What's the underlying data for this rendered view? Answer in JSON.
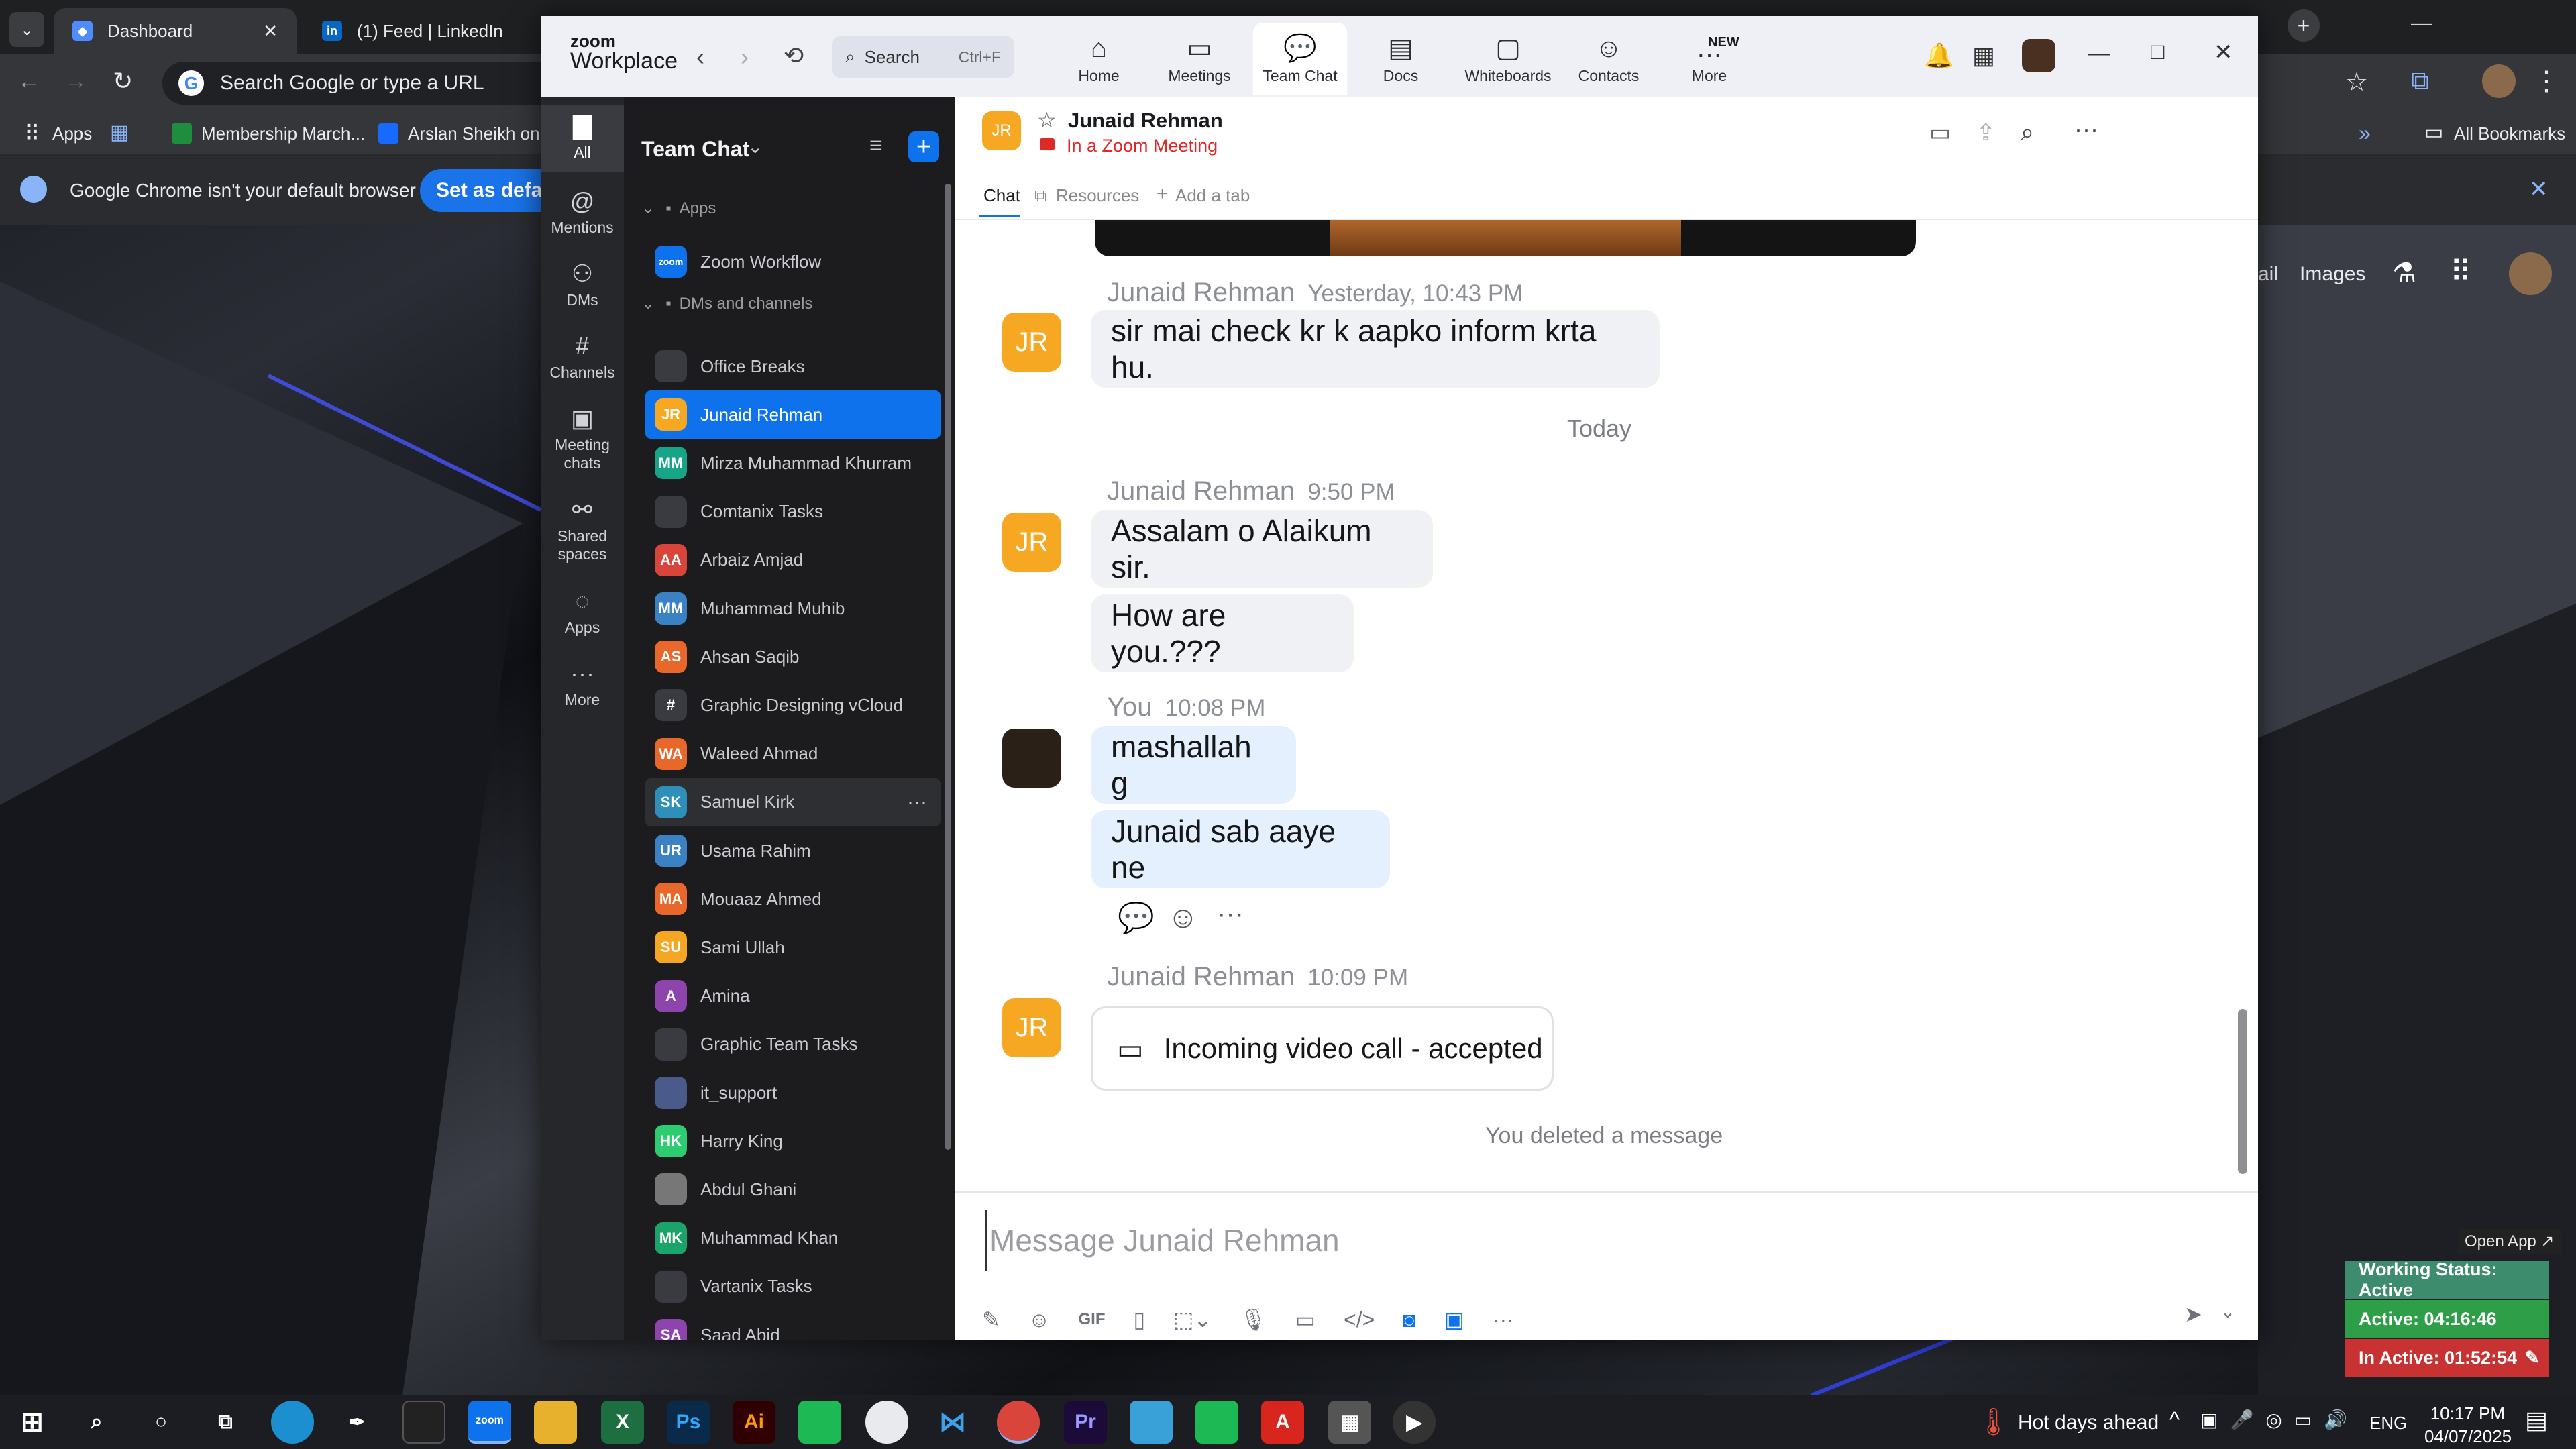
{
  "browser": {
    "tabs": [
      {
        "label": "Dashboard"
      },
      {
        "label": "(1) Feed | LinkedIn"
      }
    ],
    "address_placeholder": "Search Google or type a URL",
    "bookmarks": [
      "Apps",
      "Membership March...",
      "Arslan Sheikh on B"
    ],
    "all_bookmarks": "All Bookmarks",
    "info_text": "Google Chrome isn't your default browser",
    "info_button": "Set as default",
    "google_links": [
      "ail",
      "Images"
    ]
  },
  "zoom": {
    "brand_top": "zoom",
    "brand_bottom": "Workplace",
    "search_label": "Search",
    "search_shortcut": "Ctrl+F",
    "nav": [
      {
        "label": "Home",
        "icon": "home-icon"
      },
      {
        "label": "Meetings",
        "icon": "video-icon"
      },
      {
        "label": "Team Chat",
        "icon": "chat-icon"
      },
      {
        "label": "Docs",
        "icon": "doc-icon"
      },
      {
        "label": "Whiteboards",
        "icon": "whiteboard-icon"
      },
      {
        "label": "Contacts",
        "icon": "contacts-icon"
      },
      {
        "label": "More",
        "icon": "more-icon",
        "badge": "NEW"
      }
    ],
    "rail": [
      {
        "label": "All"
      },
      {
        "label": "Mentions"
      },
      {
        "label": "DMs"
      },
      {
        "label": "Channels"
      },
      {
        "label": "Meeting chats"
      },
      {
        "label": "Shared spaces"
      },
      {
        "label": "Apps"
      },
      {
        "label": "More"
      }
    ],
    "list_title": "Team Chat",
    "section_apps": "Apps",
    "app_item": "Zoom Workflow",
    "section_dms": "DMs and channels",
    "contacts": [
      {
        "name": "Office Breaks",
        "avatar": "",
        "color": "#3a3b40"
      },
      {
        "name": "Junaid Rehman",
        "avatar": "JR",
        "color": "#f7a823"
      },
      {
        "name": "Mirza Muhammad Khurram",
        "avatar": "MM",
        "color": "#17a589"
      },
      {
        "name": "Comtanix Tasks",
        "avatar": "",
        "color": "#3a3b40"
      },
      {
        "name": "Arbaiz Amjad",
        "avatar": "AA",
        "color": "#d9453b"
      },
      {
        "name": "Muhammad Muhib",
        "avatar": "MM",
        "color": "#3b82c4"
      },
      {
        "name": "Ahsan Saqib",
        "avatar": "AS",
        "color": "#e8672a"
      },
      {
        "name": "Graphic Designing vCloud",
        "avatar": "#",
        "color": "#3a3b40"
      },
      {
        "name": "Waleed Ahmad",
        "avatar": "WA",
        "color": "#e8672a"
      },
      {
        "name": "Samuel Kirk",
        "avatar": "SK",
        "color": "#2e8fb8"
      },
      {
        "name": "Usama Rahim",
        "avatar": "UR",
        "color": "#3b82c4"
      },
      {
        "name": "Mouaaz Ahmed",
        "avatar": "MA",
        "color": "#e8672a"
      },
      {
        "name": "Sami Ullah",
        "avatar": "SU",
        "color": "#f5a623"
      },
      {
        "name": "Amina",
        "avatar": "A",
        "color": "#8e44ad"
      },
      {
        "name": "Graphic Team Tasks",
        "avatar": "",
        "color": "#3a3b40"
      },
      {
        "name": "it_support",
        "avatar": "",
        "color": "#4a5a8a"
      },
      {
        "name": "Harry King",
        "avatar": "HK",
        "color": "#2ecc71"
      },
      {
        "name": "Abdul Ghani",
        "avatar": "",
        "color": "#777"
      },
      {
        "name": "Muhammad Khan",
        "avatar": "MK",
        "color": "#1aa36a"
      },
      {
        "name": "Vartanix Tasks",
        "avatar": "",
        "color": "#3a3b40"
      },
      {
        "name": "Saad Abid",
        "avatar": "SA",
        "color": "#8e44ad"
      }
    ],
    "chat": {
      "contact_name": "Junaid Rehman",
      "contact_status": "In a Zoom Meeting",
      "tabs": [
        "Chat",
        "Resources",
        "Add a tab"
      ],
      "m1_name": "Junaid Rehman",
      "m1_time": "Yesterday, 10:43 PM",
      "m1_text": "sir mai check kr k aapko inform krta hu.",
      "day_divider": "Today",
      "m2_name": "Junaid Rehman",
      "m2_time": "9:50 PM",
      "m2_text1": "Assalam o Alaikum sir.",
      "m2_text2": "How are you.???",
      "m3_name": "You",
      "m3_time": "10:08 PM",
      "m3_text1": "mashallah g",
      "m3_text2": "Junaid sab aaye ne",
      "m4_name": "Junaid Rehman",
      "m4_time": "10:09 PM",
      "m4_text": "Incoming video call - accepted",
      "deleted": "You deleted a message",
      "composer_placeholder": "Message Junaid Rehman"
    }
  },
  "widget": {
    "open_app": "Open App ↗",
    "working": "Working Status: Active",
    "active": "Active: 04:16:46",
    "inactive": "In Active: 01:52:54"
  },
  "taskbar": {
    "weather": "Hot days ahead",
    "lang": "ENG",
    "time": "10:17 PM",
    "date": "04/07/2025"
  }
}
